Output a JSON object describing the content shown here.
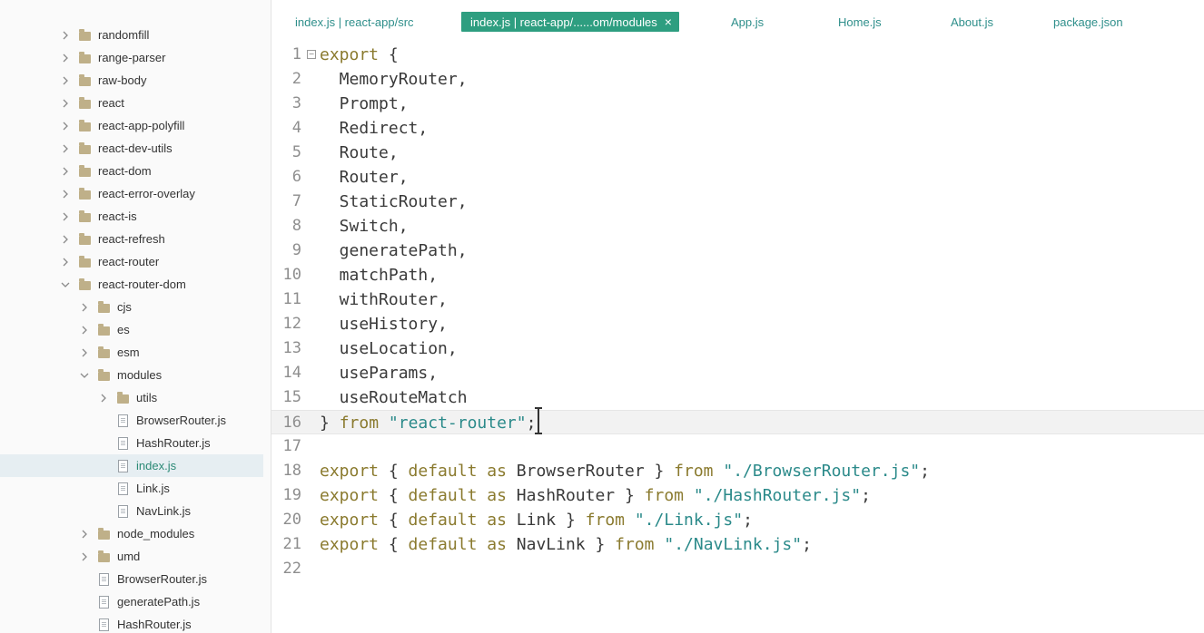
{
  "sidebar": {
    "items": [
      {
        "label": "randomfill",
        "type": "folder",
        "depth": 0,
        "expanded": false
      },
      {
        "label": "range-parser",
        "type": "folder",
        "depth": 0,
        "expanded": false
      },
      {
        "label": "raw-body",
        "type": "folder",
        "depth": 0,
        "expanded": false
      },
      {
        "label": "react",
        "type": "folder",
        "depth": 0,
        "expanded": false
      },
      {
        "label": "react-app-polyfill",
        "type": "folder",
        "depth": 0,
        "expanded": false
      },
      {
        "label": "react-dev-utils",
        "type": "folder",
        "depth": 0,
        "expanded": false
      },
      {
        "label": "react-dom",
        "type": "folder",
        "depth": 0,
        "expanded": false
      },
      {
        "label": "react-error-overlay",
        "type": "folder",
        "depth": 0,
        "expanded": false
      },
      {
        "label": "react-is",
        "type": "folder",
        "depth": 0,
        "expanded": false
      },
      {
        "label": "react-refresh",
        "type": "folder",
        "depth": 0,
        "expanded": false
      },
      {
        "label": "react-router",
        "type": "folder",
        "depth": 0,
        "expanded": false
      },
      {
        "label": "react-router-dom",
        "type": "folder",
        "depth": 0,
        "expanded": true
      },
      {
        "label": "cjs",
        "type": "folder",
        "depth": 1,
        "expanded": false
      },
      {
        "label": "es",
        "type": "folder",
        "depth": 1,
        "expanded": false
      },
      {
        "label": "esm",
        "type": "folder",
        "depth": 1,
        "expanded": false
      },
      {
        "label": "modules",
        "type": "folder",
        "depth": 1,
        "expanded": true
      },
      {
        "label": "utils",
        "type": "folder",
        "depth": 2,
        "expanded": false
      },
      {
        "label": "BrowserRouter.js",
        "type": "file",
        "depth": 2
      },
      {
        "label": "HashRouter.js",
        "type": "file",
        "depth": 2
      },
      {
        "label": "index.js",
        "type": "file",
        "depth": 2,
        "selected": true
      },
      {
        "label": "Link.js",
        "type": "file",
        "depth": 2
      },
      {
        "label": "NavLink.js",
        "type": "file",
        "depth": 2
      },
      {
        "label": "node_modules",
        "type": "folder",
        "depth": 1,
        "expanded": false
      },
      {
        "label": "umd",
        "type": "folder",
        "depth": 1,
        "expanded": false
      },
      {
        "label": "BrowserRouter.js",
        "type": "file",
        "depth": 1
      },
      {
        "label": "generatePath.js",
        "type": "file",
        "depth": 1
      },
      {
        "label": "HashRouter.js",
        "type": "file",
        "depth": 1
      }
    ]
  },
  "tabs": [
    {
      "label": "index.js | react-app/src",
      "active": false
    },
    {
      "label": "index.js | react-app/......om/modules",
      "active": true,
      "close": "×"
    },
    {
      "label": "App.js",
      "active": false
    },
    {
      "label": "Home.js",
      "active": false
    },
    {
      "label": "About.js",
      "active": false
    },
    {
      "label": "package.json",
      "active": false
    }
  ],
  "editor": {
    "current_line": 16,
    "lines": [
      [
        {
          "t": "export",
          "c": "kw"
        },
        {
          "t": " {",
          "c": "id"
        }
      ],
      [
        {
          "t": "  MemoryRouter,",
          "c": "id"
        }
      ],
      [
        {
          "t": "  Prompt,",
          "c": "id"
        }
      ],
      [
        {
          "t": "  Redirect,",
          "c": "id"
        }
      ],
      [
        {
          "t": "  Route,",
          "c": "id"
        }
      ],
      [
        {
          "t": "  Router,",
          "c": "id"
        }
      ],
      [
        {
          "t": "  StaticRouter,",
          "c": "id"
        }
      ],
      [
        {
          "t": "  Switch,",
          "c": "id"
        }
      ],
      [
        {
          "t": "  generatePath,",
          "c": "id"
        }
      ],
      [
        {
          "t": "  matchPath,",
          "c": "id"
        }
      ],
      [
        {
          "t": "  withRouter,",
          "c": "id"
        }
      ],
      [
        {
          "t": "  useHistory,",
          "c": "id"
        }
      ],
      [
        {
          "t": "  useLocation,",
          "c": "id"
        }
      ],
      [
        {
          "t": "  useParams,",
          "c": "id"
        }
      ],
      [
        {
          "t": "  useRouteMatch",
          "c": "id"
        }
      ],
      [
        {
          "t": "} ",
          "c": "id"
        },
        {
          "t": "from",
          "c": "kw"
        },
        {
          "t": " ",
          "c": "id"
        },
        {
          "t": "\"react-router\"",
          "c": "str"
        },
        {
          "t": ";",
          "c": "id"
        }
      ],
      [],
      [
        {
          "t": "export",
          "c": "kw"
        },
        {
          "t": " { ",
          "c": "id"
        },
        {
          "t": "default",
          "c": "kw"
        },
        {
          "t": " ",
          "c": "id"
        },
        {
          "t": "as",
          "c": "kw"
        },
        {
          "t": " BrowserRouter } ",
          "c": "id"
        },
        {
          "t": "from",
          "c": "kw"
        },
        {
          "t": " ",
          "c": "id"
        },
        {
          "t": "\"./BrowserRouter.js\"",
          "c": "str"
        },
        {
          "t": ";",
          "c": "id"
        }
      ],
      [
        {
          "t": "export",
          "c": "kw"
        },
        {
          "t": " { ",
          "c": "id"
        },
        {
          "t": "default",
          "c": "kw"
        },
        {
          "t": " ",
          "c": "id"
        },
        {
          "t": "as",
          "c": "kw"
        },
        {
          "t": " HashRouter } ",
          "c": "id"
        },
        {
          "t": "from",
          "c": "kw"
        },
        {
          "t": " ",
          "c": "id"
        },
        {
          "t": "\"./HashRouter.js\"",
          "c": "str"
        },
        {
          "t": ";",
          "c": "id"
        }
      ],
      [
        {
          "t": "export",
          "c": "kw"
        },
        {
          "t": " { ",
          "c": "id"
        },
        {
          "t": "default",
          "c": "kw"
        },
        {
          "t": " ",
          "c": "id"
        },
        {
          "t": "as",
          "c": "kw"
        },
        {
          "t": " Link } ",
          "c": "id"
        },
        {
          "t": "from",
          "c": "kw"
        },
        {
          "t": " ",
          "c": "id"
        },
        {
          "t": "\"./Link.js\"",
          "c": "str"
        },
        {
          "t": ";",
          "c": "id"
        }
      ],
      [
        {
          "t": "export",
          "c": "kw"
        },
        {
          "t": " { ",
          "c": "id"
        },
        {
          "t": "default",
          "c": "kw"
        },
        {
          "t": " ",
          "c": "id"
        },
        {
          "t": "as",
          "c": "kw"
        },
        {
          "t": " NavLink } ",
          "c": "id"
        },
        {
          "t": "from",
          "c": "kw"
        },
        {
          "t": " ",
          "c": "id"
        },
        {
          "t": "\"./NavLink.js\"",
          "c": "str"
        },
        {
          "t": ";",
          "c": "id"
        }
      ],
      []
    ]
  }
}
